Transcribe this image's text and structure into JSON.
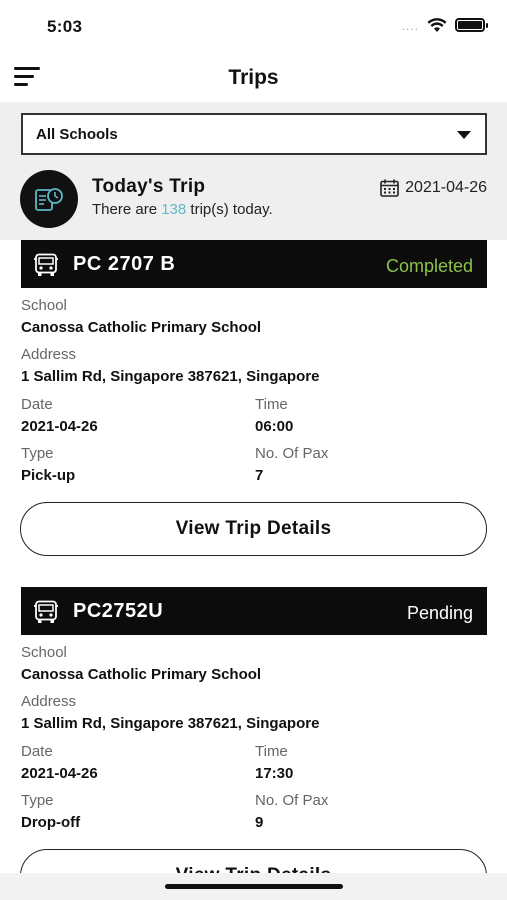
{
  "status_bar": {
    "time": "5:03",
    "signal": "...."
  },
  "nav": {
    "title": "Trips"
  },
  "filter": {
    "selected": "All Schools"
  },
  "today": {
    "title": "Today's Trip",
    "sub_prefix": "There are ",
    "count": "138",
    "sub_suffix": " trip(s) today.",
    "date": "2021-04-26"
  },
  "labels": {
    "school": "School",
    "address": "Address",
    "date": "Date",
    "time": "Time",
    "type": "Type",
    "pax": "No. Of Pax",
    "view_details": "View Trip Details"
  },
  "trips": [
    {
      "plate": "PC 2707 B",
      "status": "Completed",
      "school": "Canossa Catholic Primary School",
      "address": "1 Sallim Rd, Singapore 387621, Singapore",
      "date": "2021-04-26",
      "time": "06:00",
      "type": "Pick-up",
      "pax": "7"
    },
    {
      "plate": "PC2752U",
      "status": "Pending",
      "school": "Canossa Catholic Primary School",
      "address": "1 Sallim Rd, Singapore 387621, Singapore",
      "date": "2021-04-26",
      "time": "17:30",
      "type": "Drop-off",
      "pax": "9"
    }
  ],
  "colors": {
    "completed": "#8bc34a",
    "count_accent": "#5fb8c7",
    "header_bg": "#0c0c0c"
  }
}
